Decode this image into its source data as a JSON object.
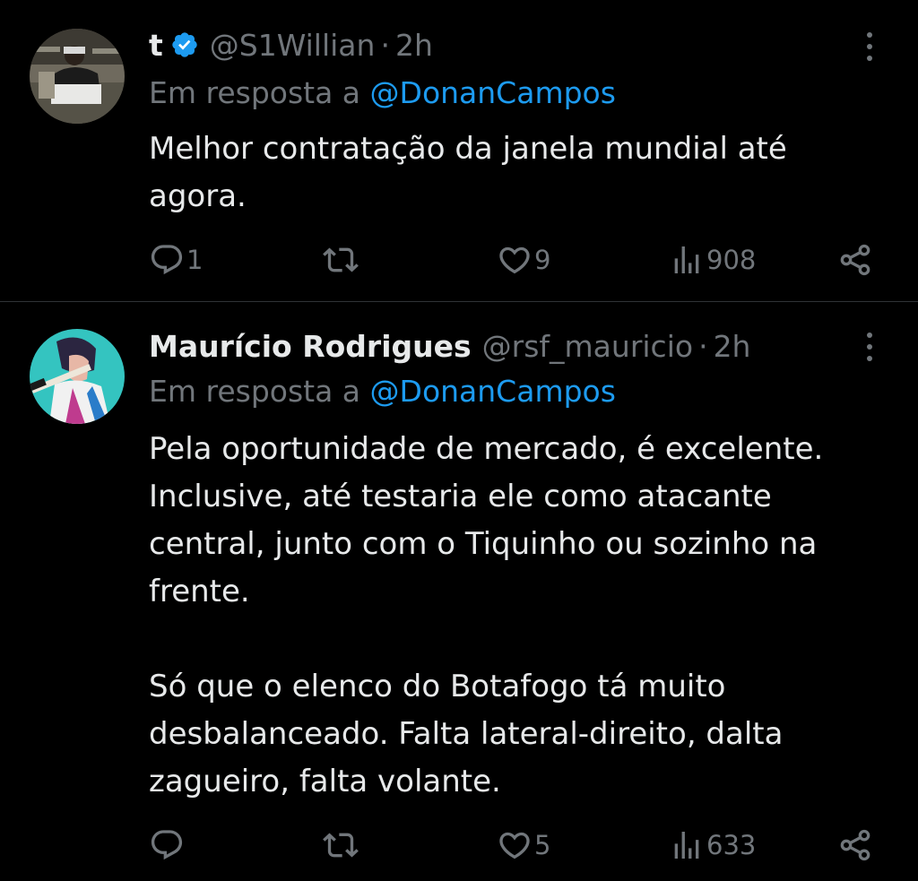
{
  "tweets": [
    {
      "display_name": "t",
      "verified": true,
      "handle": "@S1Willian",
      "separator": "·",
      "time": "2h",
      "reply_prefix": "Em resposta a",
      "reply_to": "@DonanCampos",
      "text_paragraphs": [
        "Melhor contratação da janela mundial até agora."
      ],
      "stats": {
        "replies": "1",
        "retweets": "",
        "likes": "9",
        "views": "908"
      }
    },
    {
      "display_name": "Maurício Rodrigues",
      "verified": false,
      "handle": "@rsf_mauricio",
      "separator": "·",
      "time": "2h",
      "reply_prefix": "Em resposta a",
      "reply_to": "@DonanCampos",
      "text_paragraphs": [
        "Pela oportunidade de mercado, é excelente. Inclusive, até testaria ele como atacante central, junto com o Tiquinho ou sozinho na frente.",
        "Só que o elenco do Botafogo tá muito desbalanceado. Falta lateral-direito, dalta zagueiro, falta volante."
      ],
      "stats": {
        "replies": "",
        "retweets": "",
        "likes": "5",
        "views": "633"
      }
    }
  ],
  "colors": {
    "background": "#000000",
    "text": "#e7e9ea",
    "muted": "#71767b",
    "accent": "#1d9bf0",
    "divider": "#2f3336"
  },
  "icons": [
    "verified-badge-icon",
    "more-icon",
    "reply-icon",
    "retweet-icon",
    "like-icon",
    "views-icon",
    "share-icon"
  ]
}
